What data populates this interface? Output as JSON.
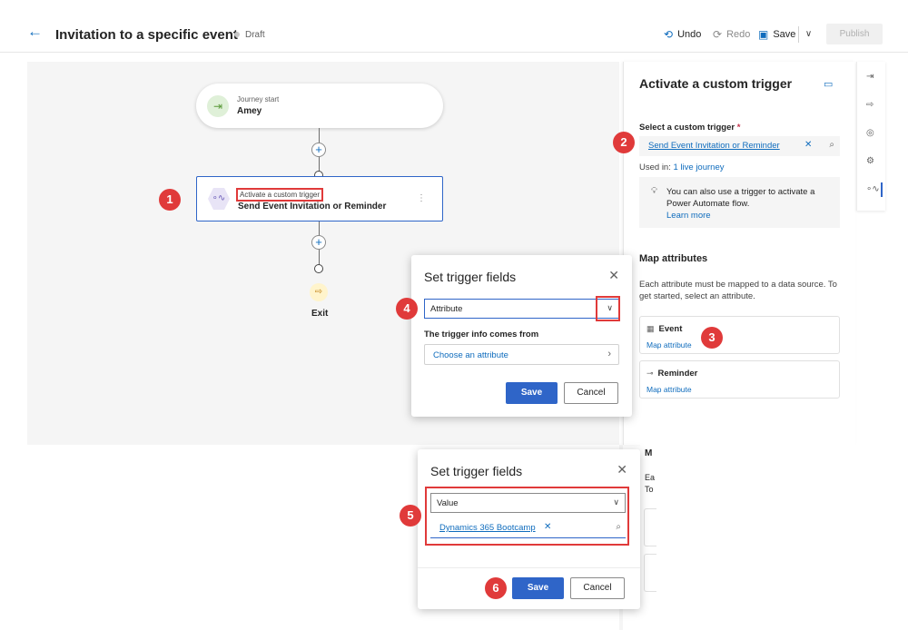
{
  "header": {
    "back_icon": "←",
    "title": "Invitation to a specific event",
    "status": "Draft",
    "undo_label": "Undo",
    "redo_label": "Redo",
    "save_label": "Save",
    "publish_label": "Publish"
  },
  "canvas": {
    "start_node": {
      "subtitle": "Journey start",
      "name": "Amey"
    },
    "trigger_node": {
      "subtitle": "Activate a custom trigger",
      "name": "Send Event Invitation or Reminder"
    },
    "exit_node": {
      "label": "Exit"
    }
  },
  "panel": {
    "title": "Activate a custom trigger",
    "select_label": "Select a custom trigger",
    "required_mark": "*",
    "selected_trigger": "Send Event Invitation or Reminder",
    "used_in_prefix": "Used in:",
    "used_in_link": "1 live journey",
    "info_text": "You can also use a trigger to activate a Power Automate flow.",
    "info_link": "Learn more",
    "map_title": "Map attributes",
    "map_desc": "Each attribute must be mapped to a data source. To get started, select an attribute.",
    "attributes": [
      {
        "name": "Event",
        "link": "Map attribute"
      },
      {
        "name": "Reminder",
        "link": "Map attribute"
      }
    ]
  },
  "modal_attribute": {
    "title": "Set trigger fields",
    "dropdown_value": "Attribute",
    "info_label": "The trigger info comes from",
    "choose_text": "Choose an attribute",
    "save_label": "Save",
    "cancel_label": "Cancel"
  },
  "modal_value": {
    "title": "Set trigger fields",
    "dropdown_value": "Value",
    "selected_value": "Dynamics 365 Bootcamp",
    "save_label": "Save",
    "cancel_label": "Cancel"
  },
  "peek_text": {
    "m": "M",
    "ea": "Ea",
    "to": "To"
  },
  "badges": [
    "1",
    "2",
    "3",
    "4",
    "5",
    "6"
  ],
  "colors": {
    "accent": "#2f65c8",
    "link": "#0f6cbd",
    "highlight": "#e03a3a"
  }
}
